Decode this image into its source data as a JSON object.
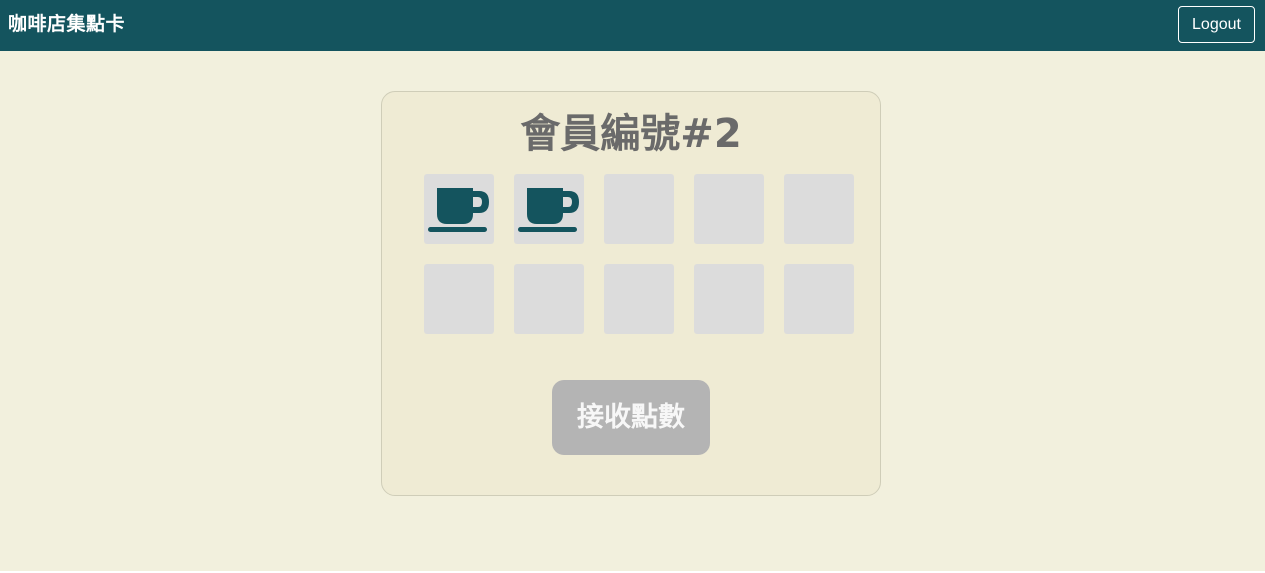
{
  "app": {
    "title": "咖啡店集點卡",
    "logout_label": "Logout"
  },
  "card": {
    "title": "會員編號#2",
    "stamps_collected": 2,
    "stamps_total": 10,
    "stamp_icon": "coffee-cup-icon",
    "claim_button_label": "接收點數",
    "claim_button_state": "disabled"
  },
  "colors": {
    "navbar": "#14545e",
    "page_background": "#f2f0dd",
    "card_background": "#efebd4",
    "stamp_empty": "#dcdcdc",
    "stamp_icon": "#14545e",
    "title_text": "#6a6a6a",
    "button_disabled": "#b4b4b4"
  }
}
